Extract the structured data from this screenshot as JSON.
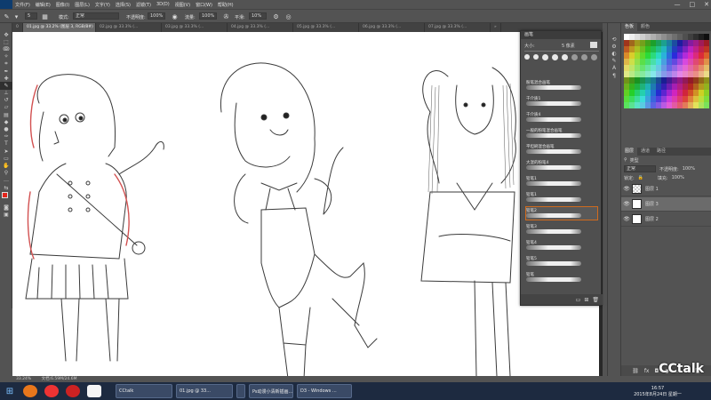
{
  "app": {
    "menus": [
      "文件(F)",
      "编辑(E)",
      "图像(I)",
      "图层(L)",
      "文字(Y)",
      "选择(S)",
      "滤镜(T)",
      "3D(D)",
      "视图(V)",
      "窗口(W)",
      "帮助(H)"
    ],
    "window_controls": [
      "—",
      "□",
      "✕"
    ]
  },
  "options_bar": {
    "mode_label": "模式:",
    "mode_value": "正常",
    "opacity_label": "不透明度:",
    "opacity_value": "100%",
    "flow_label": "流量:",
    "flow_value": "100%",
    "smooth_label": "平滑:",
    "smooth_value": "10%",
    "brush_size": "5"
  },
  "tabs": [
    {
      "label": "0",
      "active": false
    },
    {
      "label": "01.jpg @ 33.2% (图层 3, RGB/8#)",
      "active": true
    },
    {
      "label": "02.jpg @ 33.3% (...",
      "active": false
    },
    {
      "label": "03.jpg @ 33.3% (...",
      "active": false
    },
    {
      "label": "04.jpg @ 33.3% (...",
      "active": false
    },
    {
      "label": "05.jpg @ 33.3% (...",
      "active": false
    },
    {
      "label": "06.jpg @ 33.3% (...",
      "active": false
    },
    {
      "label": "07.jpg @ 33.3% (...",
      "active": false
    },
    {
      "label": "»",
      "active": false
    }
  ],
  "brush_panel": {
    "title": "画笔",
    "size_label": "大小:",
    "size_value": "5 像素",
    "presets_sizes": [
      "3",
      "5",
      "9",
      "13",
      "19",
      "5",
      "9",
      "13"
    ],
    "brushes": [
      "粉笔混合画笔",
      "干介质1",
      "干介质4",
      "一般的粉笔混合画笔",
      "平坦刷混合画笔",
      "大湿的粉笔4",
      "铅笔1",
      "铅笔1",
      "铅笔2",
      "铅笔3",
      "铅笔4",
      "铅笔5",
      "铅笔"
    ],
    "selected_index": 8
  },
  "swatches_panel": {
    "tabs": [
      "色板",
      "颜色"
    ]
  },
  "layers_panel": {
    "tabs": [
      "图层",
      "通道",
      "路径"
    ],
    "filter_label": "类型",
    "blend_mode": "正常",
    "opacity_label": "不透明度:",
    "opacity_value": "100%",
    "lock_label": "锁定:",
    "fill_label": "填充:",
    "fill_value": "100%",
    "layers": [
      {
        "name": "图层 1",
        "active": false
      },
      {
        "name": "图层 3",
        "active": true
      },
      {
        "name": "图层 2",
        "active": false
      }
    ]
  },
  "status_bar": {
    "zoom": "33.24%",
    "doc": "文档:6.59M/24.6M"
  },
  "taskbar": {
    "tasks": [
      {
        "label": "CCtalk"
      },
      {
        "label": "01.jpg @ 33..."
      },
      {
        "label": ""
      },
      {
        "label": "Ps动漫小清新插画..."
      },
      {
        "label": "D3 - Windows ..."
      }
    ],
    "clock_time": "16:57",
    "clock_date": "2015年8月24日 星期一"
  },
  "watermark": "CCtalk",
  "colors": {
    "ui_bg": "#535353",
    "panel_dark": "#3c3c3c",
    "canvas": "#ffffff",
    "selection": "#d06b1e",
    "taskbar": "#1d2a40"
  }
}
